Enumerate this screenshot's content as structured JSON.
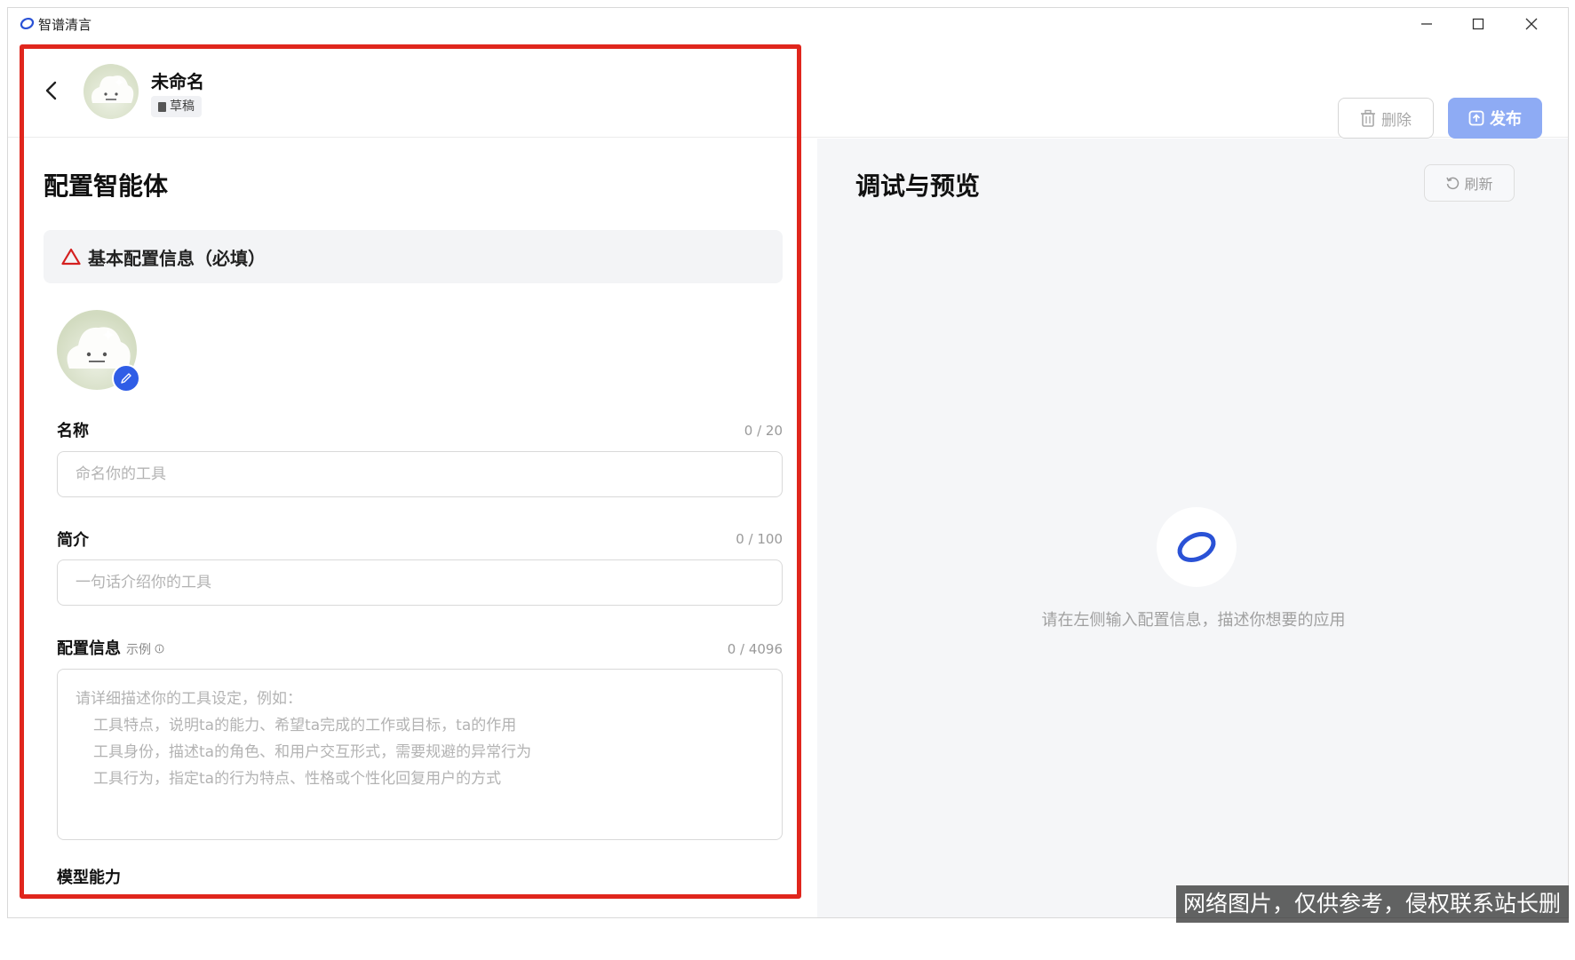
{
  "titlebar": {
    "app_title": "智谱清言",
    "minimize": "—",
    "maximize": "☐",
    "close": "✕"
  },
  "header": {
    "back": "‹",
    "agent_name": "未命名",
    "status_badge": "草稿",
    "delete_label": "删除",
    "publish_label": "发布"
  },
  "config": {
    "title": "配置智能体",
    "basic_section": "基本配置信息（必填）",
    "name": {
      "label": "名称",
      "counter": "0 / 20",
      "placeholder": "命名你的工具"
    },
    "intro": {
      "label": "简介",
      "counter": "0 / 100",
      "placeholder": "一句话介绍你的工具"
    },
    "settings": {
      "label": "配置信息",
      "hint": "示例",
      "counter": "0 / 4096",
      "placeholder_lines": [
        "请详细描述你的工具设定，例如：",
        "工具特点，说明ta的能力、希望ta完成的工作或目标，ta的作用",
        "工具身份，描述ta的角色、和用户交互形式，需要规避的异常行为",
        "工具行为，指定ta的行为特点、性格或个性化回复用户的方式"
      ]
    },
    "model_label": "模型能力"
  },
  "preview": {
    "title": "调试与预览",
    "refresh_label": "刷新",
    "empty_text": "请在左侧输入配置信息，描述你想要的应用"
  },
  "watermark": "网络图片，仅供参考，侵权联系站长删除",
  "colors": {
    "accent": "#2f5de6",
    "publish_disabled": "#8eabf4",
    "annotation_red": "#e0261d",
    "preview_bg": "#f5f6f8"
  }
}
